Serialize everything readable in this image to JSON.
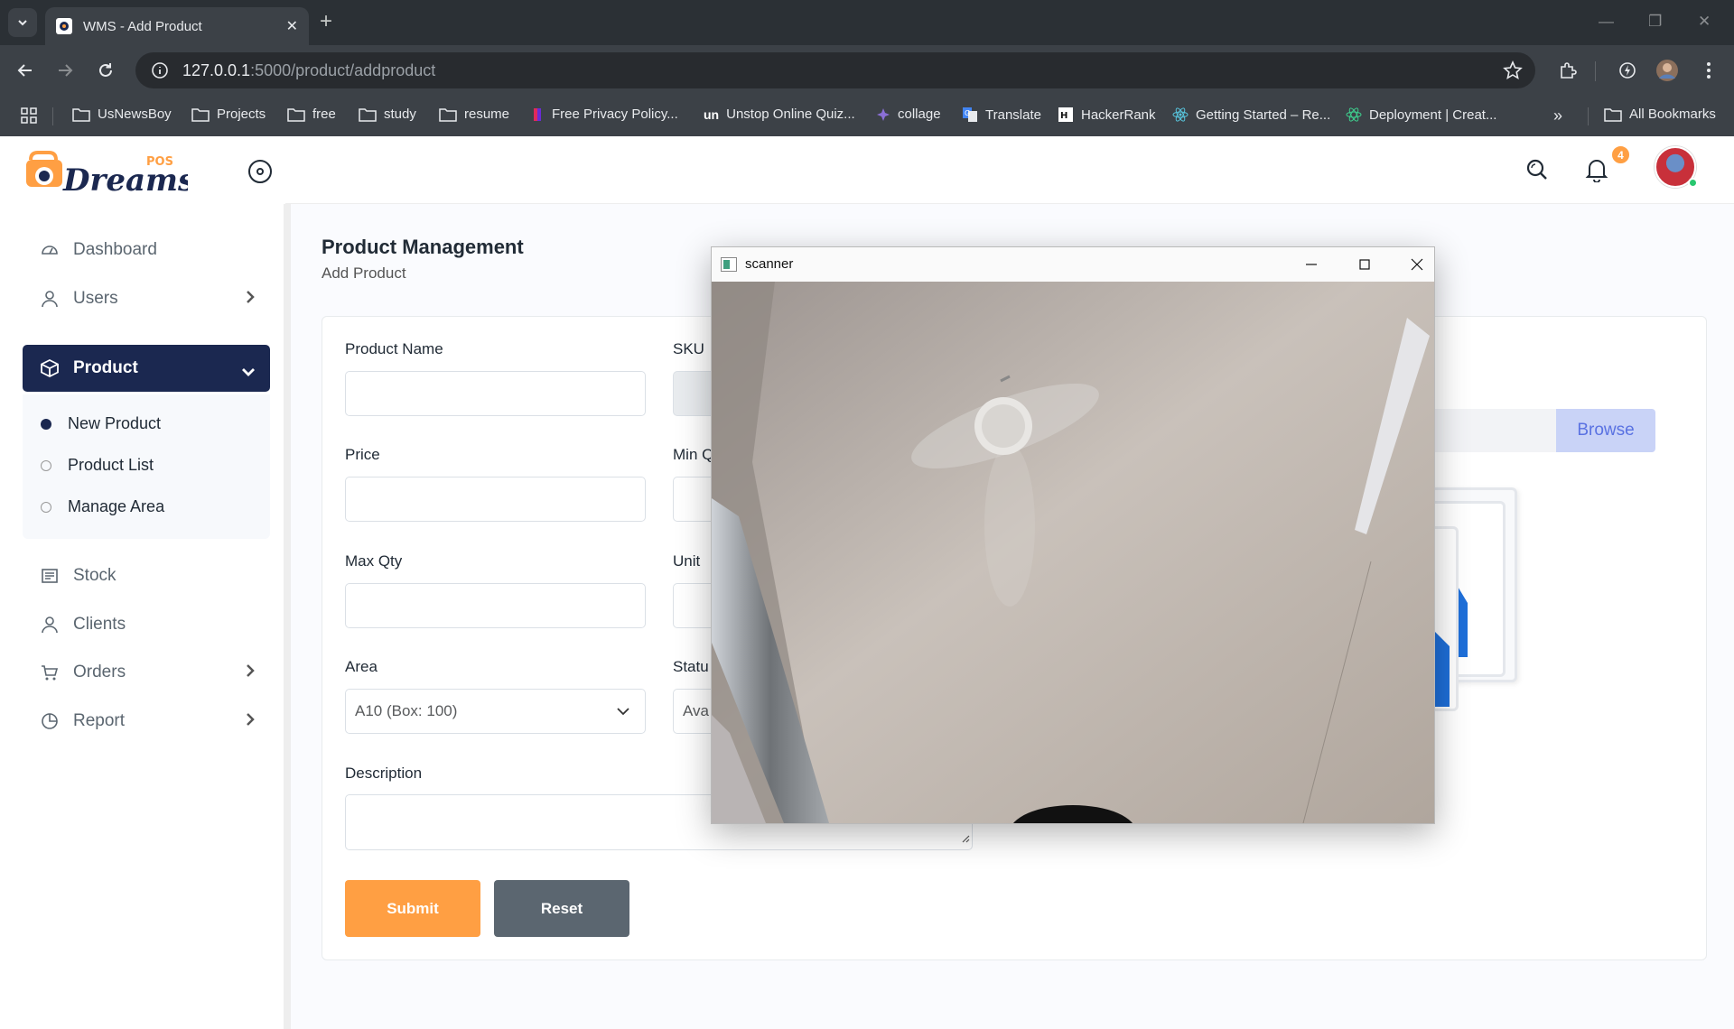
{
  "browser": {
    "tab_title": "WMS - Add Product",
    "url_host": "127.0.0.1",
    "url_path": ":5000/product/addproduct",
    "bookmarks": [
      {
        "label": "UsNewsBoy",
        "icon": "folder-icon"
      },
      {
        "label": "Projects",
        "icon": "folder-icon"
      },
      {
        "label": "free",
        "icon": "folder-icon"
      },
      {
        "label": "study",
        "icon": "folder-icon"
      },
      {
        "label": "resume",
        "icon": "folder-icon"
      },
      {
        "label": "Free Privacy Policy...",
        "icon": "privacy-favicon"
      },
      {
        "label": "Unstop Online Quiz...",
        "icon": "unstop-favicon"
      },
      {
        "label": "collage",
        "icon": "collage-favicon"
      },
      {
        "label": "Translate",
        "icon": "translate-favicon"
      },
      {
        "label": "HackerRank",
        "icon": "hackerrank-favicon"
      },
      {
        "label": "Getting Started – Re...",
        "icon": "react-favicon"
      },
      {
        "label": "Deployment | Creat...",
        "icon": "react-favicon"
      }
    ],
    "all_bookmarks": "All Bookmarks"
  },
  "logo": {
    "text": "Dreams",
    "badge": "POS"
  },
  "sidebar": {
    "items": [
      {
        "label": "Dashboard",
        "icon": "dashboard-icon"
      },
      {
        "label": "Users",
        "icon": "user-icon"
      },
      {
        "label": "Product",
        "icon": "box-icon"
      },
      {
        "label": "Stock",
        "icon": "stock-icon"
      },
      {
        "label": "Clients",
        "icon": "user-icon"
      },
      {
        "label": "Orders",
        "icon": "cart-icon"
      },
      {
        "label": "Report",
        "icon": "pie-icon"
      }
    ],
    "submenu": [
      {
        "label": "New Product",
        "active": true
      },
      {
        "label": "Product List",
        "active": false
      },
      {
        "label": "Manage Area",
        "active": false
      }
    ]
  },
  "header": {
    "notification_count": "4"
  },
  "page": {
    "title": "Product Management",
    "subtitle": "Add Product"
  },
  "form": {
    "product_name": {
      "label": "Product Name",
      "value": ""
    },
    "sku": {
      "label": "SKU",
      "value": ""
    },
    "price": {
      "label": "Price",
      "value": ""
    },
    "min_qty": {
      "label": "Min Q",
      "value": ""
    },
    "max_qty": {
      "label": "Max Qty",
      "value": ""
    },
    "unit": {
      "label": "Unit",
      "value": ""
    },
    "area": {
      "label": "Area",
      "value": "A10 (Box: 100)"
    },
    "status": {
      "label": "Statu",
      "value": "Ava"
    },
    "description": {
      "label": "Description",
      "value": ""
    },
    "submit_label": "Submit",
    "reset_label": "Reset",
    "browse_label": "Browse"
  },
  "scanner": {
    "title": "scanner"
  },
  "colors": {
    "active_nav": "#1b2850",
    "submit": "#ff9f43",
    "reset": "#5b6670",
    "browse_bg": "#c9d3f7",
    "browse_text": "#5a72e2",
    "badge": "#ff9f43"
  }
}
